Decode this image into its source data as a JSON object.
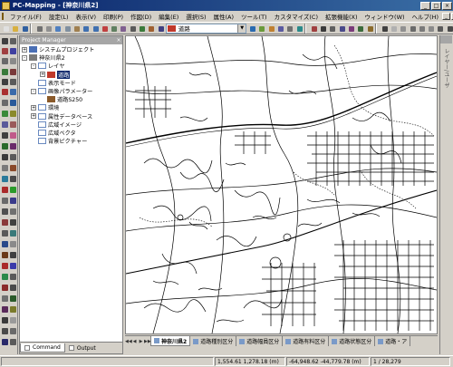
{
  "window": {
    "title": "PC-Mapping - [神奈川県2]",
    "min_label": "_",
    "max_label": "□",
    "close_label": "×"
  },
  "menu": {
    "items": [
      "ファイル(F)",
      "設定(L)",
      "表示(V)",
      "印刷(P)",
      "作図(D)",
      "編集(E)",
      "選択(S)",
      "属性(A)",
      "ツール(T)",
      "カスタマイズ(C)",
      "拡張機能(X)",
      "ウィンドウ(W)",
      "ヘルプ(H)"
    ],
    "mdi_min": "_",
    "mdi_restore": "❐",
    "mdi_close": "×"
  },
  "toolbar": {
    "layer_select_value": "道路",
    "dropdown_arrow": "▼"
  },
  "panel": {
    "header": "Project Manager",
    "close": "×",
    "tree": [
      {
        "label": "システムプロジェクト",
        "level": 0,
        "icon": "folder-blue",
        "expander": "+"
      },
      {
        "label": "神奈川県2",
        "level": 0,
        "icon": "folder-gray",
        "expander": "-"
      },
      {
        "label": "レイヤ",
        "level": 1,
        "icon": "box",
        "expander": "-"
      },
      {
        "label": "道路",
        "level": 2,
        "icon": "layer",
        "expander": "+",
        "selected": true
      },
      {
        "label": "表示モード",
        "level": 1,
        "icon": "box",
        "expander": ""
      },
      {
        "label": "画像パラメーター",
        "level": 1,
        "icon": "box",
        "expander": "-"
      },
      {
        "label": "道路S250",
        "level": 2,
        "icon": "raster",
        "expander": ""
      },
      {
        "label": "環境",
        "level": 1,
        "icon": "box",
        "expander": "+"
      },
      {
        "label": "属性データベース",
        "level": 1,
        "icon": "box",
        "expander": "+"
      },
      {
        "label": "広域イメージ",
        "level": 1,
        "icon": "box",
        "expander": ""
      },
      {
        "label": "広域ベクタ",
        "level": 1,
        "icon": "box",
        "expander": ""
      },
      {
        "label": "背景ピクチャー",
        "level": 1,
        "icon": "box",
        "expander": ""
      }
    ],
    "tabs": [
      "Command",
      "Output"
    ]
  },
  "right_panel": {
    "label": "レイヤー/ユーザ"
  },
  "sheet_tabs": {
    "nav": [
      "◀◀",
      "◀",
      "▶",
      "▶▶"
    ],
    "items": [
      "神奈川県2",
      "道路種別区分",
      "道路幅員区分",
      "道路有料区分",
      "道路状態区分",
      "道路・ア"
    ]
  },
  "status": {
    "coord1": "1,554.61 1,278.18 (m)",
    "coord2": "-64,948.62 -44,779.78 (m)",
    "scale": "1 / 28,279"
  }
}
